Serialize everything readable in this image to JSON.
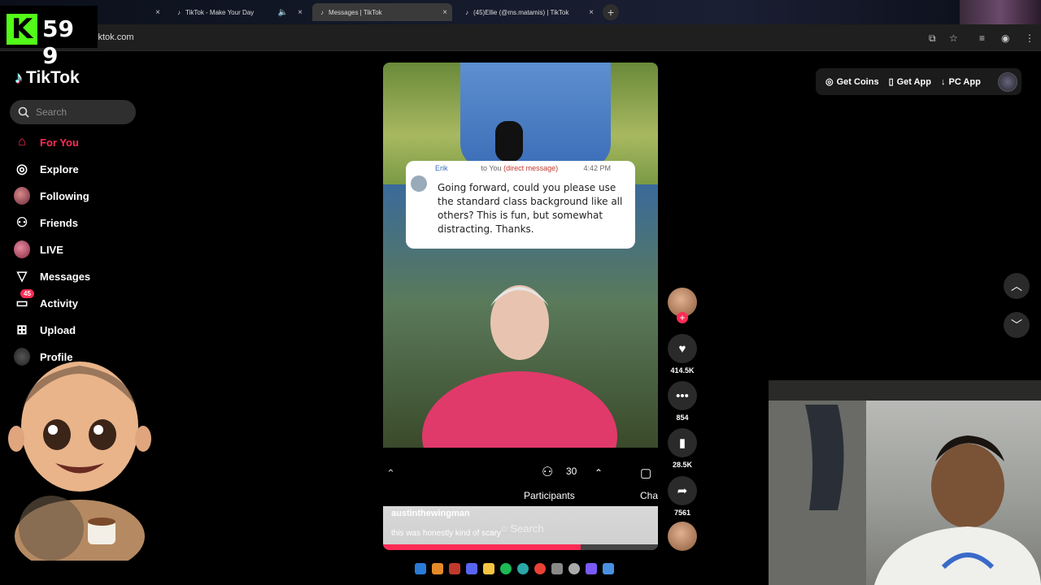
{
  "browser": {
    "tabs": [
      {
        "label": "",
        "active": false
      },
      {
        "label": "TikTok - Make Your Day",
        "active": false
      },
      {
        "label": "Messages | TikTok",
        "active": true
      },
      {
        "label": "(45)Ellie (@ms.matamis) | TikTok",
        "active": false
      }
    ],
    "url": "tiktok.com",
    "close_glyph": "×",
    "new_tab_glyph": "+"
  },
  "overlay": {
    "kick_letter": "K",
    "kick_count": "59 9"
  },
  "sidebar": {
    "logo_text": "TikTok",
    "search_placeholder": "Search",
    "items": [
      {
        "label": "For You",
        "icon": "home-icon",
        "active": true
      },
      {
        "label": "Explore",
        "icon": "compass-icon"
      },
      {
        "label": "Following",
        "icon": "avatar"
      },
      {
        "label": "Friends",
        "icon": "friends-icon"
      },
      {
        "label": "LIVE",
        "icon": "avatar"
      },
      {
        "label": "Messages",
        "icon": "send-icon"
      },
      {
        "label": "Activity",
        "icon": "inbox-icon",
        "badge": "45"
      },
      {
        "label": "Upload",
        "icon": "plus-square-icon"
      },
      {
        "label": "Profile",
        "icon": "avatar"
      }
    ]
  },
  "video": {
    "message": {
      "sender": "Erik",
      "to": "to You",
      "type": "(direct message)",
      "time": "4:42 PM",
      "body": "Going forward, could you please use the standard class background like all others?  This is fun, but somewhat distracting.  Thanks."
    },
    "participants_count": "30",
    "participants_label": "Participants",
    "chat_label": "Cha",
    "author": "austinthewingman",
    "caption": "this was honestly kind of scary",
    "search_label": "Search",
    "progress": 0.72
  },
  "actions": {
    "likes": "414.5K",
    "comments": "854",
    "saves": "28.5K",
    "shares": "7561"
  },
  "topbar": {
    "get_coins": "Get Coins",
    "get_app": "Get App",
    "pc_app": "PC App"
  },
  "colors": {
    "accent": "#fe2c55",
    "kick_green": "#53fc18"
  }
}
